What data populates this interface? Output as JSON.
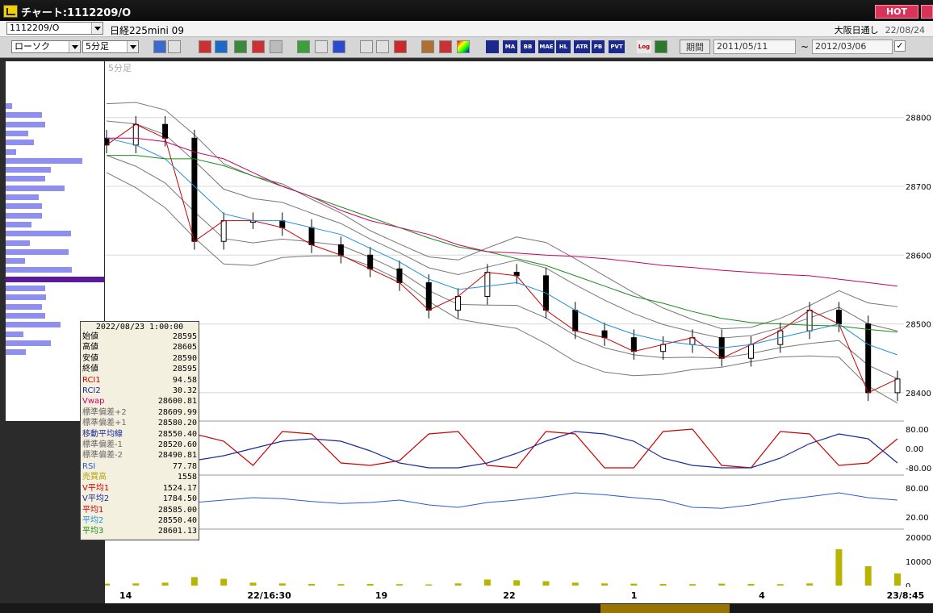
{
  "window": {
    "title": "チャート:1112209/O",
    "hot_label": "HOT"
  },
  "toolbar1": {
    "symbol_code": "1112209/O",
    "symbol_name": "日経225mini 09",
    "market_note": "大阪日通し",
    "market_date": "22/08/24"
  },
  "toolbar2": {
    "chart_type": "ローソク",
    "timeframe": "5分足",
    "period_label": "期間",
    "date_from": "2011/05/11",
    "date_sep": "~",
    "date_to": "2012/03/06",
    "check_mark": "✓",
    "text_tools": [
      "MA",
      "BB",
      "MAE",
      "HL",
      "ATR",
      "PB",
      "PVT",
      "Log"
    ]
  },
  "chart": {
    "pane_label": "5分足",
    "price_axis": [
      "28800",
      "28700",
      "28600",
      "28500",
      "28400"
    ],
    "osc_axis": [
      "80.00",
      "0.00",
      "-80.00"
    ],
    "rsi_axis": [
      "80.00",
      "20.00"
    ],
    "vol_axis": [
      "20000",
      "10000",
      "0"
    ],
    "x_labels": [
      "14",
      "22/16:30",
      "19",
      "22",
      "1",
      "4",
      "23/8:45"
    ],
    "colors": {
      "ma1": "#cc0000",
      "ma2": "#1e90d8",
      "ma3": "#1a8a1a",
      "vwap": "#cc0066",
      "band": "#777777",
      "rci1": "#cc0000",
      "rci2": "#1a2a9a",
      "rsi": "#2a5ad8",
      "volume": "#b8b400"
    }
  },
  "chart_data": [
    {
      "type": "line",
      "title": "5分足",
      "xlabel": "",
      "ylabel": "",
      "categories": [
        "14",
        "22/16:30",
        "19",
        "22",
        "1",
        "4",
        "23/8:45"
      ],
      "ylim": [
        28360,
        28870
      ],
      "series": [
        {
          "name": "平均1",
          "values": [
            28760,
            28790,
            28770,
            28620,
            28650,
            28650,
            28640,
            28615,
            28600,
            28580,
            28560,
            28520,
            28540,
            28575,
            28570,
            28520,
            28490,
            28480,
            28460,
            28470,
            28480,
            28450,
            28470,
            28490,
            28520,
            28500,
            28400,
            28420
          ]
        },
        {
          "name": "平均2",
          "values": [
            28770,
            28760,
            28740,
            28700,
            28660,
            28650,
            28650,
            28640,
            28630,
            28610,
            28590,
            28565,
            28550,
            28555,
            28560,
            28545,
            28520,
            28500,
            28485,
            28475,
            28470,
            28465,
            28470,
            28480,
            28490,
            28500,
            28470,
            28455
          ]
        },
        {
          "name": "平均3",
          "values": [
            28745,
            28745,
            28740,
            28740,
            28730,
            28715,
            28700,
            28685,
            28670,
            28655,
            28640,
            28625,
            28612,
            28605,
            28595,
            28585,
            28570,
            28555,
            28540,
            28530,
            28518,
            28508,
            28502,
            28500,
            28498,
            28497,
            28492,
            28488
          ]
        },
        {
          "name": "Vwap",
          "values": [
            28770,
            28770,
            28765,
            28750,
            28740,
            28720,
            28700,
            28685,
            28665,
            28650,
            28640,
            28630,
            28615,
            28605,
            28603,
            28600,
            28598,
            28595,
            28590,
            28585,
            28582,
            28578,
            28575,
            28572,
            28570,
            28565,
            28560,
            28555
          ]
        }
      ]
    },
    {
      "type": "line",
      "title": "",
      "series": [
        {
          "name": "RCI1",
          "values": [
            -60,
            -70,
            -40,
            60,
            30,
            -70,
            70,
            60,
            -60,
            -70,
            -50,
            60,
            70,
            -70,
            -80,
            70,
            60,
            -80,
            -80,
            70,
            80,
            -70,
            -80,
            70,
            60,
            -70,
            -60,
            40
          ]
        },
        {
          "name": "RCI2",
          "values": [
            -50,
            -55,
            -60,
            -50,
            -30,
            0,
            30,
            40,
            30,
            -10,
            -60,
            -80,
            -80,
            -60,
            -20,
            30,
            70,
            60,
            30,
            -40,
            -70,
            -80,
            -80,
            -40,
            20,
            60,
            40,
            -60
          ]
        }
      ]
    },
    {
      "type": "line",
      "title": "",
      "series": [
        {
          "name": "RSI",
          "values": [
            40,
            42,
            45,
            50,
            55,
            60,
            58,
            52,
            48,
            50,
            55,
            45,
            40,
            50,
            55,
            62,
            70,
            66,
            60,
            55,
            40,
            38,
            45,
            55,
            62,
            70,
            60,
            55
          ]
        }
      ]
    },
    {
      "type": "bar",
      "title": "",
      "series": [
        {
          "name": "売買高",
          "values": [
            800,
            900,
            1200,
            3500,
            2800,
            1200,
            900,
            700,
            600,
            700,
            600,
            500,
            900,
            2500,
            2200,
            1800,
            1200,
            900,
            800,
            700,
            600,
            800,
            700,
            600,
            900,
            15000,
            8000,
            5000
          ]
        }
      ]
    }
  ],
  "volume_profile": [
    0.07,
    0.42,
    0.45,
    0.26,
    0.32,
    0.12,
    0.88,
    0.52,
    0.45,
    0.68,
    0.38,
    0.42,
    0.42,
    0.3,
    0.75,
    0.28,
    0.72,
    0.22,
    0.76,
    1.0,
    0.45,
    0.46,
    0.42,
    0.45,
    0.63,
    0.2,
    0.52,
    0.23
  ],
  "info": {
    "datetime": "2022/08/23  1:00:00",
    "rows": [
      {
        "k": "始値",
        "v": "28595",
        "c": "#000"
      },
      {
        "k": "高値",
        "v": "28605",
        "c": "#000"
      },
      {
        "k": "安値",
        "v": "28590",
        "c": "#000"
      },
      {
        "k": "終値",
        "v": "28595",
        "c": "#000"
      },
      {
        "k": "RCI1",
        "v": "94.58",
        "c": "#cc0000"
      },
      {
        "k": "RCI2",
        "v": "30.32",
        "c": "#1a2a9a"
      },
      {
        "k": "Vwap",
        "v": "28600.81",
        "c": "#cc0066"
      },
      {
        "k": "標準偏差+2",
        "v": "28609.99",
        "c": "#666"
      },
      {
        "k": "標準偏差+1",
        "v": "28580.20",
        "c": "#666"
      },
      {
        "k": "移動平均線",
        "v": "28550.40",
        "c": "#1a2a9a"
      },
      {
        "k": "標準偏差-1",
        "v": "28520.60",
        "c": "#666"
      },
      {
        "k": "標準偏差-2",
        "v": "28490.81",
        "c": "#666"
      },
      {
        "k": "RSI",
        "v": "77.78",
        "c": "#2a5ad8"
      },
      {
        "k": "売買高",
        "v": "1558",
        "c": "#b8a000"
      },
      {
        "k": "V平均1",
        "v": "1524.17",
        "c": "#cc0000"
      },
      {
        "k": "V平均2",
        "v": "1784.50",
        "c": "#1a2a9a"
      },
      {
        "k": "平均1",
        "v": "28585.00",
        "c": "#cc0000"
      },
      {
        "k": "平均2",
        "v": "28550.40",
        "c": "#1e90d8"
      },
      {
        "k": "平均3",
        "v": "28601.13",
        "c": "#1a8a1a"
      }
    ]
  }
}
